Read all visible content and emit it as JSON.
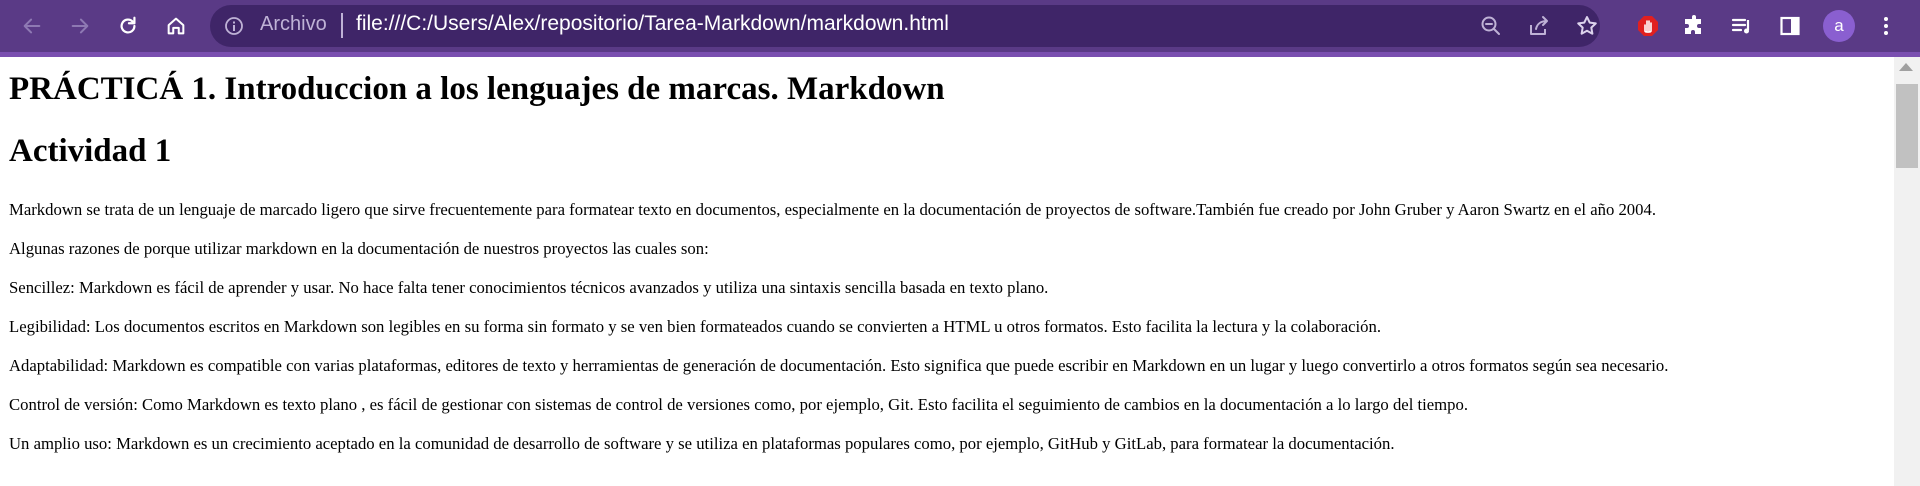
{
  "browser": {
    "secure_label": "Archivo",
    "url": "file:///C:/Users/Alex/repositorio/Tarea-Markdown/markdown.html",
    "avatar_letter": "a",
    "accent_color": "#5a3a86",
    "icons": [
      "back-icon",
      "forward-icon",
      "reload-icon",
      "home-icon",
      "info-icon",
      "zoom-out-icon",
      "share-icon",
      "bookmark-star-icon",
      "adblock-icon",
      "extensions-icon",
      "reading-list-icon",
      "side-panel-icon",
      "menu-icon"
    ]
  },
  "document": {
    "title": "PRÁCTICÁ 1. Introduccion a los lenguajes de marcas. Markdown",
    "subtitle": "Actividad 1",
    "paragraphs": [
      "Markdown se trata de un lenguaje de marcado ligero que sirve frecuentemente para formatear texto en documentos, especialmente en la documentación de proyectos de software.También fue creado por John Gruber y Aaron Swartz en el año 2004.",
      "Algunas razones de porque utilizar markdown en la documentación de nuestros proyectos las cuales son:",
      "Sencillez: Markdown es fácil de aprender y usar. No hace falta tener conocimientos técnicos avanzados y utiliza una sintaxis sencilla basada en texto plano.",
      "Legibilidad: Los documentos escritos en Markdown son legibles en su forma sin formato y se ven bien formateados cuando se convierten a HTML u otros formatos. Esto facilita la lectura y la colaboración.",
      "Adaptabilidad: Markdown es compatible con varias plataformas, editores de texto y herramientas de generación de documentación. Esto significa que puede escribir en Markdown en un lugar y luego convertirlo a otros formatos según sea necesario.",
      "Control de versión: Como Markdown es texto plano , es fácil de gestionar con sistemas de control de versiones como, por ejemplo, Git. Esto facilita el seguimiento de cambios en la documentación a lo largo del tiempo.",
      "Un amplio uso: Markdown es un crecimiento aceptado en la comunidad de desarrollo de software y se utiliza en plataformas populares como, por ejemplo, GitHub y GitLab, para formatear la documentación."
    ]
  }
}
